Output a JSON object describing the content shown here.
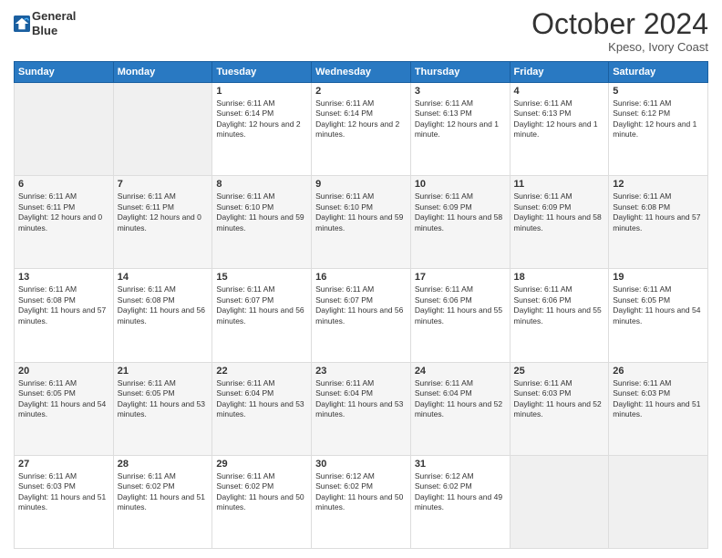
{
  "header": {
    "logo_line1": "General",
    "logo_line2": "Blue",
    "month_title": "October 2024",
    "location": "Kpeso, Ivory Coast"
  },
  "weekdays": [
    "Sunday",
    "Monday",
    "Tuesday",
    "Wednesday",
    "Thursday",
    "Friday",
    "Saturday"
  ],
  "weeks": [
    [
      {
        "day": "",
        "sunrise": "",
        "sunset": "",
        "daylight": ""
      },
      {
        "day": "",
        "sunrise": "",
        "sunset": "",
        "daylight": ""
      },
      {
        "day": "1",
        "sunrise": "Sunrise: 6:11 AM",
        "sunset": "Sunset: 6:14 PM",
        "daylight": "Daylight: 12 hours and 2 minutes."
      },
      {
        "day": "2",
        "sunrise": "Sunrise: 6:11 AM",
        "sunset": "Sunset: 6:14 PM",
        "daylight": "Daylight: 12 hours and 2 minutes."
      },
      {
        "day": "3",
        "sunrise": "Sunrise: 6:11 AM",
        "sunset": "Sunset: 6:13 PM",
        "daylight": "Daylight: 12 hours and 1 minute."
      },
      {
        "day": "4",
        "sunrise": "Sunrise: 6:11 AM",
        "sunset": "Sunset: 6:13 PM",
        "daylight": "Daylight: 12 hours and 1 minute."
      },
      {
        "day": "5",
        "sunrise": "Sunrise: 6:11 AM",
        "sunset": "Sunset: 6:12 PM",
        "daylight": "Daylight: 12 hours and 1 minute."
      }
    ],
    [
      {
        "day": "6",
        "sunrise": "Sunrise: 6:11 AM",
        "sunset": "Sunset: 6:11 PM",
        "daylight": "Daylight: 12 hours and 0 minutes."
      },
      {
        "day": "7",
        "sunrise": "Sunrise: 6:11 AM",
        "sunset": "Sunset: 6:11 PM",
        "daylight": "Daylight: 12 hours and 0 minutes."
      },
      {
        "day": "8",
        "sunrise": "Sunrise: 6:11 AM",
        "sunset": "Sunset: 6:10 PM",
        "daylight": "Daylight: 11 hours and 59 minutes."
      },
      {
        "day": "9",
        "sunrise": "Sunrise: 6:11 AM",
        "sunset": "Sunset: 6:10 PM",
        "daylight": "Daylight: 11 hours and 59 minutes."
      },
      {
        "day": "10",
        "sunrise": "Sunrise: 6:11 AM",
        "sunset": "Sunset: 6:09 PM",
        "daylight": "Daylight: 11 hours and 58 minutes."
      },
      {
        "day": "11",
        "sunrise": "Sunrise: 6:11 AM",
        "sunset": "Sunset: 6:09 PM",
        "daylight": "Daylight: 11 hours and 58 minutes."
      },
      {
        "day": "12",
        "sunrise": "Sunrise: 6:11 AM",
        "sunset": "Sunset: 6:08 PM",
        "daylight": "Daylight: 11 hours and 57 minutes."
      }
    ],
    [
      {
        "day": "13",
        "sunrise": "Sunrise: 6:11 AM",
        "sunset": "Sunset: 6:08 PM",
        "daylight": "Daylight: 11 hours and 57 minutes."
      },
      {
        "day": "14",
        "sunrise": "Sunrise: 6:11 AM",
        "sunset": "Sunset: 6:08 PM",
        "daylight": "Daylight: 11 hours and 56 minutes."
      },
      {
        "day": "15",
        "sunrise": "Sunrise: 6:11 AM",
        "sunset": "Sunset: 6:07 PM",
        "daylight": "Daylight: 11 hours and 56 minutes."
      },
      {
        "day": "16",
        "sunrise": "Sunrise: 6:11 AM",
        "sunset": "Sunset: 6:07 PM",
        "daylight": "Daylight: 11 hours and 56 minutes."
      },
      {
        "day": "17",
        "sunrise": "Sunrise: 6:11 AM",
        "sunset": "Sunset: 6:06 PM",
        "daylight": "Daylight: 11 hours and 55 minutes."
      },
      {
        "day": "18",
        "sunrise": "Sunrise: 6:11 AM",
        "sunset": "Sunset: 6:06 PM",
        "daylight": "Daylight: 11 hours and 55 minutes."
      },
      {
        "day": "19",
        "sunrise": "Sunrise: 6:11 AM",
        "sunset": "Sunset: 6:05 PM",
        "daylight": "Daylight: 11 hours and 54 minutes."
      }
    ],
    [
      {
        "day": "20",
        "sunrise": "Sunrise: 6:11 AM",
        "sunset": "Sunset: 6:05 PM",
        "daylight": "Daylight: 11 hours and 54 minutes."
      },
      {
        "day": "21",
        "sunrise": "Sunrise: 6:11 AM",
        "sunset": "Sunset: 6:05 PM",
        "daylight": "Daylight: 11 hours and 53 minutes."
      },
      {
        "day": "22",
        "sunrise": "Sunrise: 6:11 AM",
        "sunset": "Sunset: 6:04 PM",
        "daylight": "Daylight: 11 hours and 53 minutes."
      },
      {
        "day": "23",
        "sunrise": "Sunrise: 6:11 AM",
        "sunset": "Sunset: 6:04 PM",
        "daylight": "Daylight: 11 hours and 53 minutes."
      },
      {
        "day": "24",
        "sunrise": "Sunrise: 6:11 AM",
        "sunset": "Sunset: 6:04 PM",
        "daylight": "Daylight: 11 hours and 52 minutes."
      },
      {
        "day": "25",
        "sunrise": "Sunrise: 6:11 AM",
        "sunset": "Sunset: 6:03 PM",
        "daylight": "Daylight: 11 hours and 52 minutes."
      },
      {
        "day": "26",
        "sunrise": "Sunrise: 6:11 AM",
        "sunset": "Sunset: 6:03 PM",
        "daylight": "Daylight: 11 hours and 51 minutes."
      }
    ],
    [
      {
        "day": "27",
        "sunrise": "Sunrise: 6:11 AM",
        "sunset": "Sunset: 6:03 PM",
        "daylight": "Daylight: 11 hours and 51 minutes."
      },
      {
        "day": "28",
        "sunrise": "Sunrise: 6:11 AM",
        "sunset": "Sunset: 6:02 PM",
        "daylight": "Daylight: 11 hours and 51 minutes."
      },
      {
        "day": "29",
        "sunrise": "Sunrise: 6:11 AM",
        "sunset": "Sunset: 6:02 PM",
        "daylight": "Daylight: 11 hours and 50 minutes."
      },
      {
        "day": "30",
        "sunrise": "Sunrise: 6:12 AM",
        "sunset": "Sunset: 6:02 PM",
        "daylight": "Daylight: 11 hours and 50 minutes."
      },
      {
        "day": "31",
        "sunrise": "Sunrise: 6:12 AM",
        "sunset": "Sunset: 6:02 PM",
        "daylight": "Daylight: 11 hours and 49 minutes."
      },
      {
        "day": "",
        "sunrise": "",
        "sunset": "",
        "daylight": ""
      },
      {
        "day": "",
        "sunrise": "",
        "sunset": "",
        "daylight": ""
      }
    ]
  ]
}
